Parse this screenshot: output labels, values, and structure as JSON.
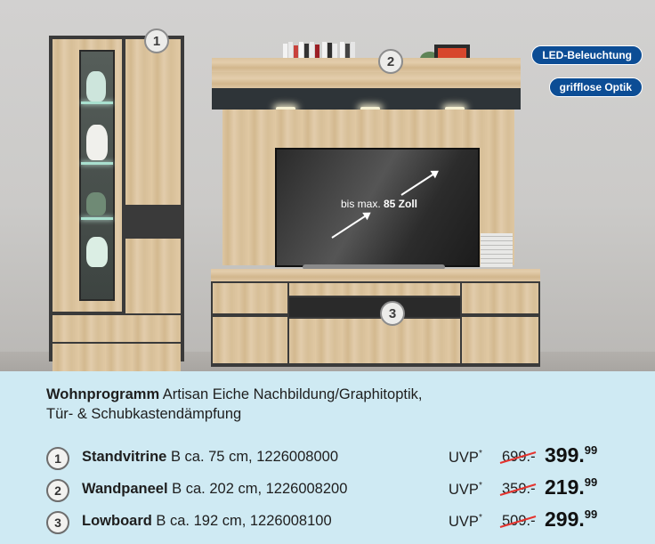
{
  "badges": {
    "led": "LED-Beleuchtung",
    "grifflos": "grifflose Optik"
  },
  "markers": [
    "1",
    "2",
    "3"
  ],
  "tv": {
    "prefix": "bis max. ",
    "size": "85 Zoll"
  },
  "description": {
    "title": "Wohnprogramm",
    "line1": " Artisan Eiche Nachbildung/Graphitoptik,",
    "line2": "Tür- & Schubkastendämpfung"
  },
  "items": [
    {
      "num": "1",
      "name": "Standvitrine",
      "details": " B ca. 75 cm, 1226008000",
      "uvp": "UVP",
      "star": "*",
      "old": "699.-",
      "price": "399.",
      "cents": "99"
    },
    {
      "num": "2",
      "name": "Wandpaneel",
      "details": " B ca. 202 cm, 1226008200",
      "uvp": "UVP",
      "star": "*",
      "old": "359.-",
      "price": "219.",
      "cents": "99"
    },
    {
      "num": "3",
      "name": "Lowboard",
      "details": " B ca. 192 cm, 1226008100",
      "uvp": "UVP",
      "star": "*",
      "old": "509.-",
      "price": "299.",
      "cents": "99"
    }
  ],
  "colors": {
    "badge": "#0c4d95",
    "background": "#cfeaf3",
    "strike": "#e5342f"
  }
}
